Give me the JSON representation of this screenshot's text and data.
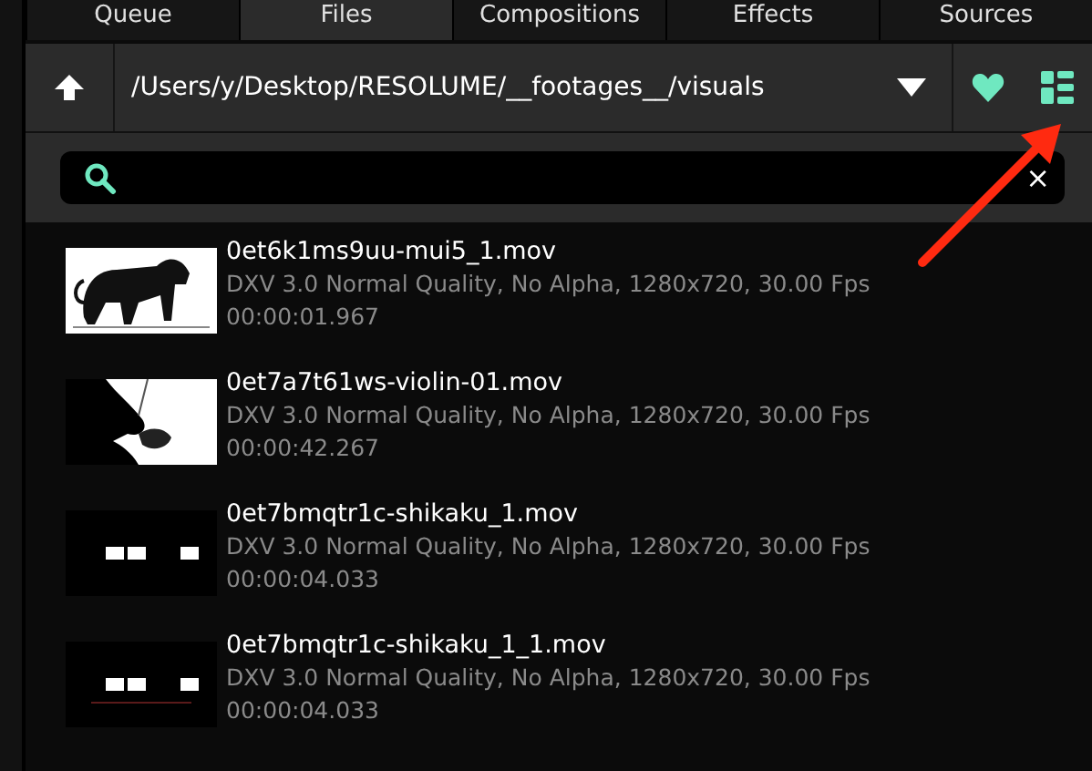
{
  "tabs": [
    {
      "label": "Queue",
      "selected": false
    },
    {
      "label": "Files",
      "selected": true
    },
    {
      "label": "Compositions",
      "selected": false
    },
    {
      "label": "Effects",
      "selected": false
    },
    {
      "label": "Sources",
      "selected": false
    }
  ],
  "path_bar": {
    "path": "/Users/y/Desktop/RESOLUME/__footages__/visuals"
  },
  "search": {
    "clear": "×"
  },
  "files": [
    {
      "name": "0et6k1ms9uu-mui5_1.mov",
      "info": "DXV 3.0 Normal Quality, No Alpha, 1280x720, 30.00 Fps",
      "duration": "00:00:01.967",
      "kind": "picture"
    },
    {
      "name": "0et7a7t61ws-violin-01.mov",
      "info": "DXV 3.0 Normal Quality, No Alpha, 1280x720, 30.00 Fps",
      "duration": "00:00:42.267",
      "kind": "picture"
    },
    {
      "name": "0et7bmqtr1c-shikaku_1.mov",
      "info": "DXV 3.0 Normal Quality, No Alpha, 1280x720, 30.00 Fps",
      "duration": "00:00:04.033",
      "kind": "picture"
    },
    {
      "name": "0et7bmqtr1c-shikaku_1_1.mov",
      "info": "DXV 3.0 Normal Quality, No Alpha, 1280x720, 30.00 Fps",
      "duration": "00:00:04.033",
      "kind": "picture"
    }
  ]
}
